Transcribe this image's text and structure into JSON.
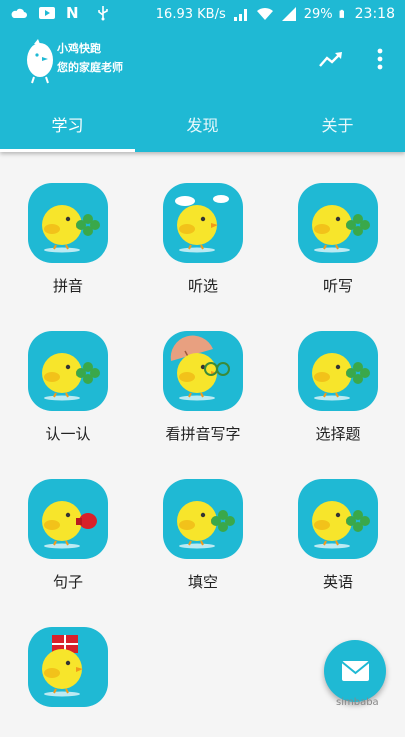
{
  "status_bar": {
    "network_speed": "16.93 KB/s",
    "battery": "29%",
    "time": "23:18"
  },
  "toolbar": {
    "brand_line1": "小鸡快跑",
    "brand_line2": "您的家庭老师"
  },
  "tabs": [
    {
      "label": "学习",
      "active": true
    },
    {
      "label": "发现",
      "active": false
    },
    {
      "label": "关于",
      "active": false
    }
  ],
  "grid": {
    "items": [
      {
        "label": "拼音",
        "icon": "chick-clover-icon"
      },
      {
        "label": "听选",
        "icon": "chick-cloud-icon"
      },
      {
        "label": "听写",
        "icon": "chick-clover-icon"
      },
      {
        "label": "认一认",
        "icon": "chick-clover-icon"
      },
      {
        "label": "看拼音写字",
        "icon": "chick-umbrella-icon"
      },
      {
        "label": "选择题",
        "icon": "chick-clover-icon"
      },
      {
        "label": "句子",
        "icon": "chick-boxing-glove-icon"
      },
      {
        "label": "填空",
        "icon": "chick-clover-icon"
      },
      {
        "label": "英语",
        "icon": "chick-clover-icon"
      },
      {
        "label": "",
        "icon": "chick-gift-icon"
      }
    ]
  },
  "colors": {
    "primary": "#1fb9d4",
    "chick": "#f7e52b",
    "clover": "#3aa84a"
  },
  "watermark": "simbaba"
}
